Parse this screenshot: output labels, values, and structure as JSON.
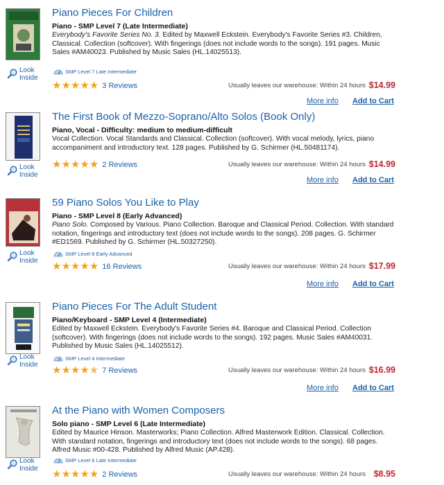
{
  "colors": {
    "link": "#1b5fa8",
    "price": "#c0262e",
    "star": "#f4a21c"
  },
  "look_inside_label": "Look Inside",
  "more_info_label": "More info",
  "add_to_cart_label": "Add to Cart",
  "products": [
    {
      "title": "Piano Pieces For Children",
      "subtitle": "Piano - SMP Level 7 (Late Intermediate)",
      "desc_italic": "Everybody's Favorite Series No. 3",
      "desc_rest": ". Edited by Maxwell Eckstein. Everybody's Favorite Series #3. Children, Classical. Collection (softcover). With fingerings (does not include words to the songs). 191 pages. Music Sales #AM40023. Published by Music Sales (HL.14025513).",
      "level_badge": "SMP Level 7 Late Intermediate",
      "rating": 5,
      "reviews": "3 Reviews",
      "shipping": "Usually leaves our warehouse: Within 24 hours",
      "price": "$14.99",
      "cover_text": "CHILDREN",
      "cover_color": "#2f7a3a"
    },
    {
      "title": "The First Book of Mezzo-Soprano/Alto Solos (Book Only)",
      "subtitle": "Piano, Vocal - Difficulty: medium to medium-difficult",
      "desc_italic": "",
      "desc_rest": "Vocal Collection. Vocal Standards and Classical. Collection (softcover). With vocal melody, lyrics, piano accompaniment and introductory text. 128 pages. Published by G. Schirmer (HL.50481174).",
      "level_badge": "",
      "rating": 5,
      "reviews": "2 Reviews",
      "shipping": "Usually leaves our warehouse: Within 24 hours",
      "price": "$14.99",
      "cover_text": "THE FIRST BOOK OF MEZZO-SOPRANO/ALTO SOLOS",
      "cover_color": "#1f2f6e"
    },
    {
      "title": "59 Piano Solos You Like to Play",
      "subtitle": "Piano - SMP Level 8 (Early Advanced)",
      "desc_italic": "Piano Solo",
      "desc_rest": ". Composed by Various. Piano Collection. Baroque and Classical Period. Collection. With standard notation, fingerings and introductory text (does not include words to the songs). 208 pages. G. Schirmer #ED1569. Published by G. Schirmer (HL.50327250).",
      "level_badge": "SMP Level 8 Early Advanced",
      "rating": 5,
      "reviews": "16 Reviews",
      "shipping": "Usually leaves our warehouse: Within 24 hours",
      "price": "$17.99",
      "cover_text": "59 Piano Solos You Like to Play",
      "cover_color": "#b8323a"
    },
    {
      "title": "Piano Pieces For The Adult Student",
      "subtitle": "Piano/Keyboard - SMP Level 4 (Intermediate)",
      "desc_italic": "",
      "desc_rest": "Edited by Maxwell Eckstein. Everybody's Favorite Series #4. Baroque and Classical Period. Collection (softcover). With fingerings (does not include words to the songs). 192 pages. Music Sales #AM40031. Published by Music Sales (HL.14025512).",
      "level_badge": "SMP Level 4 Intermediate",
      "rating": 4.5,
      "reviews": "7 Reviews",
      "shipping": "Usually leaves our warehouse: Within 24 hours",
      "price": "$16.99",
      "cover_text": "PIANO PIECES FOR THE ADULT STUDENT",
      "cover_color": "#2a6b3b"
    },
    {
      "title": "At the Piano with Women Composers",
      "subtitle": "Solo piano - SMP Level 6 (Late Intermediate)",
      "desc_italic": "",
      "desc_rest": "Edited by Maurice Hinson. Masterworks; Piano Collection. Alfred Masterwork Edition. Classical. Collection. With standard notation, fingerings and introductory text (does not include words to the songs). 68 pages. Alfred Music #00-428. Published by Alfred Music (AP.428).",
      "level_badge": "SMP Level 6 Late Intermediate",
      "rating": 5,
      "reviews": "2 Reviews",
      "shipping": "Usually leaves our warehouse: Within 24 hours",
      "price": "$8.95",
      "cover_text": "WOMEN COMPOSERS",
      "cover_color": "#e8e6e0"
    }
  ]
}
